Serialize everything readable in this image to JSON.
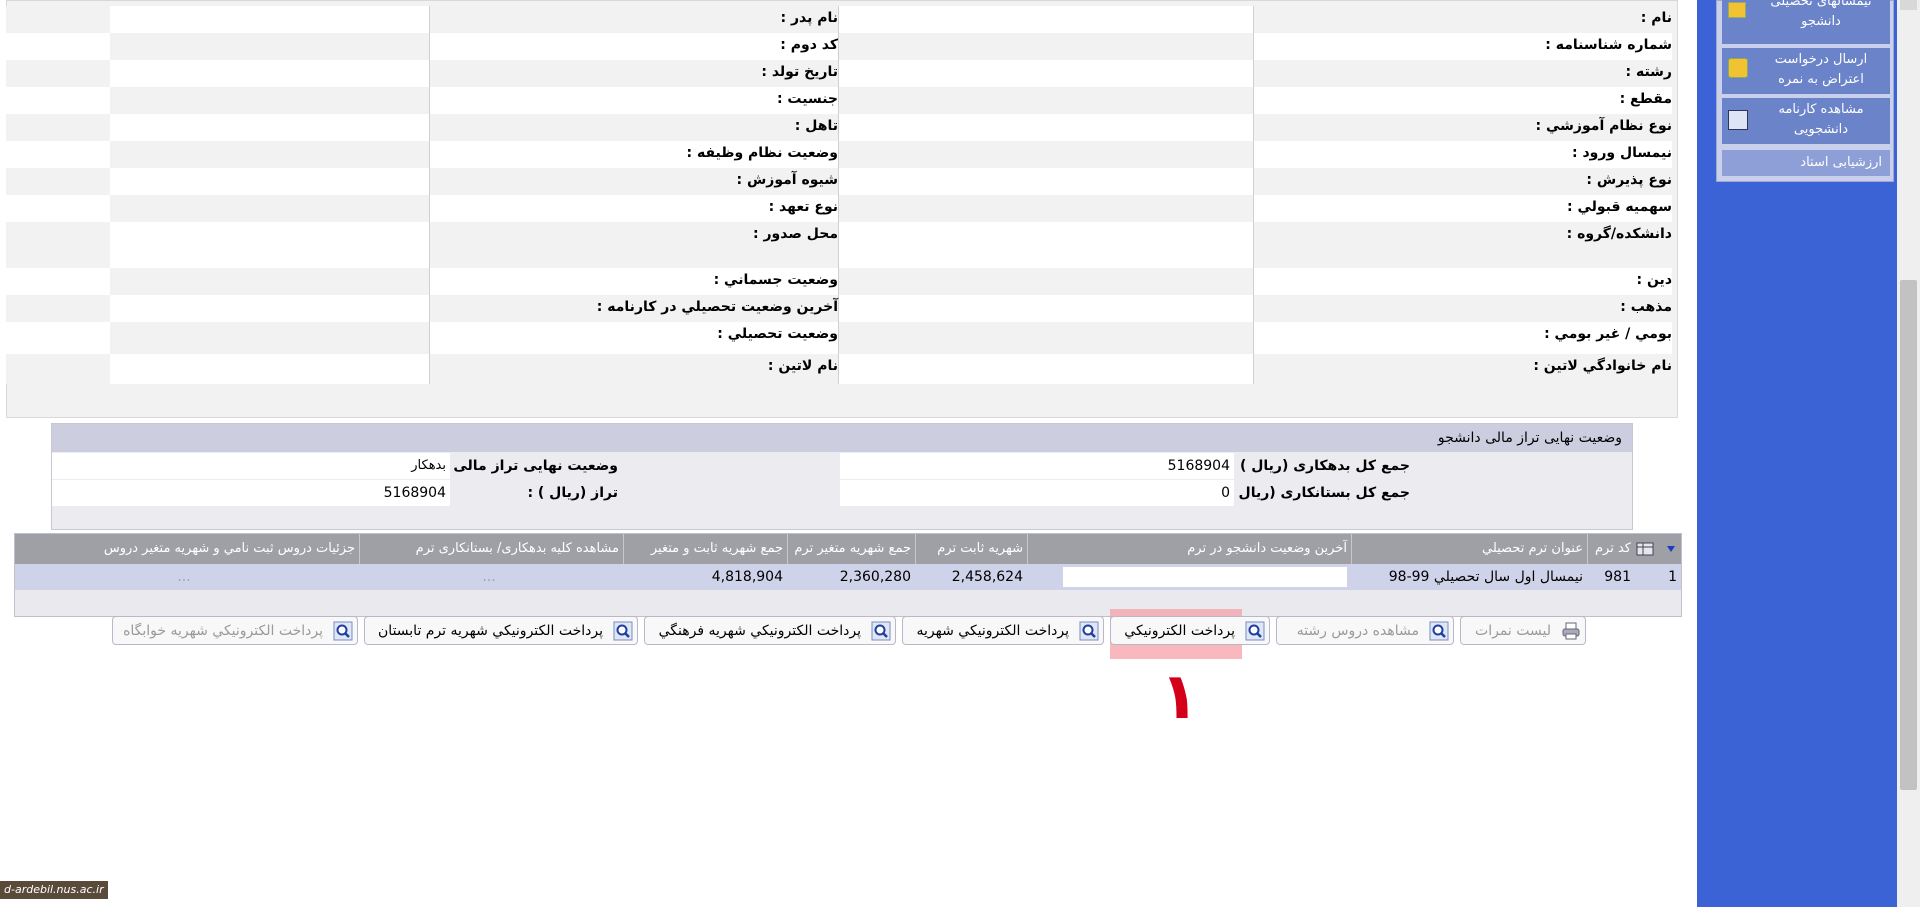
{
  "student_info": {
    "rows": [
      {
        "right_label": "نام :",
        "left_label": "نام پدر :"
      },
      {
        "right_label": "شماره شناسنامه :",
        "left_label": "کد دوم :"
      },
      {
        "right_label": "رشته :",
        "left_label": "تاريخ تولد :"
      },
      {
        "right_label": "مقطع :",
        "left_label": "جنسيت :"
      },
      {
        "right_label": "نوع نظام آموزشي :",
        "left_label": "تاهل :"
      },
      {
        "right_label": "نيمسال ورود :",
        "left_label": "وضعيت نظام وظيفه :"
      },
      {
        "right_label": "نوع پذيرش :",
        "left_label": "شيوه آموزش :"
      },
      {
        "right_label": "سهميه قبولي :",
        "left_label": "نوع تعهد :"
      },
      {
        "right_label": "دانشکده/گروه :",
        "left_label": "محل صدور :"
      },
      {
        "right_label": "دين :",
        "left_label": "وضعيت جسماني :"
      },
      {
        "right_label": "مذهب :",
        "left_label": "آخرين وضعيت تحصيلي در کارنامه :"
      },
      {
        "right_label": "بومي / غير بومي :",
        "left_label": "وضعيت تحصيلي :"
      },
      {
        "right_label": "نام خانوادگي لاتين :",
        "left_label": "نام لاتين :"
      }
    ]
  },
  "financial": {
    "title": "وضعیت نهایی تراز مالی دانشجو",
    "total_debit_label": "جمع کل بدهکاری (ریال ) :",
    "total_debit_value": "5168904",
    "final_status_label": "وضعیت نهایی تراز مالی :",
    "final_status_value": "بدهکار",
    "total_credit_label": "جمع کل بستانکاری (ریال ) :",
    "total_credit_value": "0",
    "balance_label": "تراز (ریال ) :",
    "balance_value": "5168904"
  },
  "grid": {
    "headers": [
      "کد ترم",
      "عنوان ترم تحصيلي",
      "آخرين وضعيت دانشجو در ترم",
      "شهريه ثابت ترم",
      "جمع شهريه متغير ترم",
      "جمع شهريه ثابت و متغير",
      "مشاهده کليه بدهکاری/ بستانکاری ترم",
      "جزئيات دروس ثبت نامي و شهريه متغير دروس"
    ],
    "row": {
      "index": "1",
      "term_code": "981",
      "term_title": "نيمسال اول سال تحصيلي 99-98",
      "last_status": "",
      "fixed_fee": "2,458,624",
      "variable_fee": "2,360,280",
      "total_fee": "4,818,904",
      "debit_credit_link": "...",
      "details_link": "..."
    }
  },
  "buttons": {
    "grade_list": "ليست نمرات",
    "view_major_courses": "مشاهده دروس رشته",
    "electronic_payment": "پرداخت الکترونيکي",
    "tuition_payment": "پرداخت الکترونيکي شهريه",
    "cultural_tuition": "پرداخت الکترونيکي شهريه فرهنگي",
    "summer_tuition": "پرداخت الکترونيکي شهريه ترم تابستان",
    "dorm_tuition": "پرداخت الکترونيکي شهريه خوابگاه"
  },
  "sidebar": {
    "items": [
      {
        "label": "نیمسالهای تحصیلی دانشجو"
      },
      {
        "label": "ارسال درخواست اعتراض به نمره"
      },
      {
        "label": "مشاهده کارنامه دانشجویی"
      },
      {
        "label": "ارزشیابی استاد"
      }
    ]
  },
  "annotation": "۱",
  "watermark": "d-ardebil.nus.ac.ir"
}
